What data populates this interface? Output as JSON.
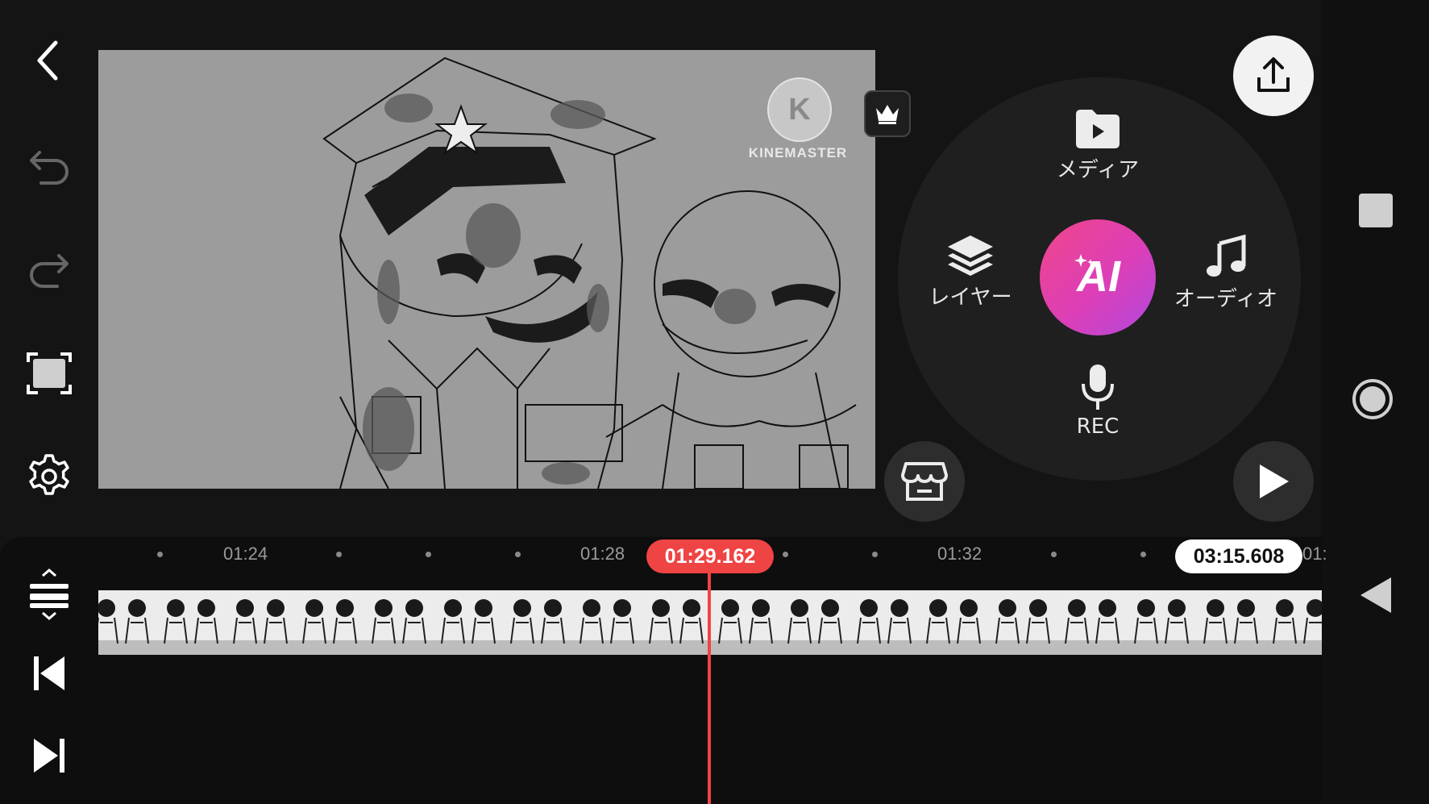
{
  "toolbar": {
    "icons": [
      "back-icon",
      "undo-icon",
      "redo-icon",
      "fullscreen-icon",
      "settings-icon"
    ]
  },
  "preview": {
    "watermark_letter": "K",
    "watermark_text": "KINEMASTER"
  },
  "menu": {
    "media_label": "メディア",
    "layer_label": "レイヤー",
    "audio_label": "オーディオ",
    "rec_label": "REC",
    "ai_label": "AI"
  },
  "timeline": {
    "ticks": [
      "01:24",
      "01:28",
      "01:32"
    ],
    "current_time": "01:29.162",
    "total_time": "03:15.608",
    "overflow_tick": "01:"
  },
  "colors": {
    "accent_red": "#ef4444",
    "ai_gradient_start": "#f0458a",
    "ai_gradient_end": "#b048e0"
  }
}
